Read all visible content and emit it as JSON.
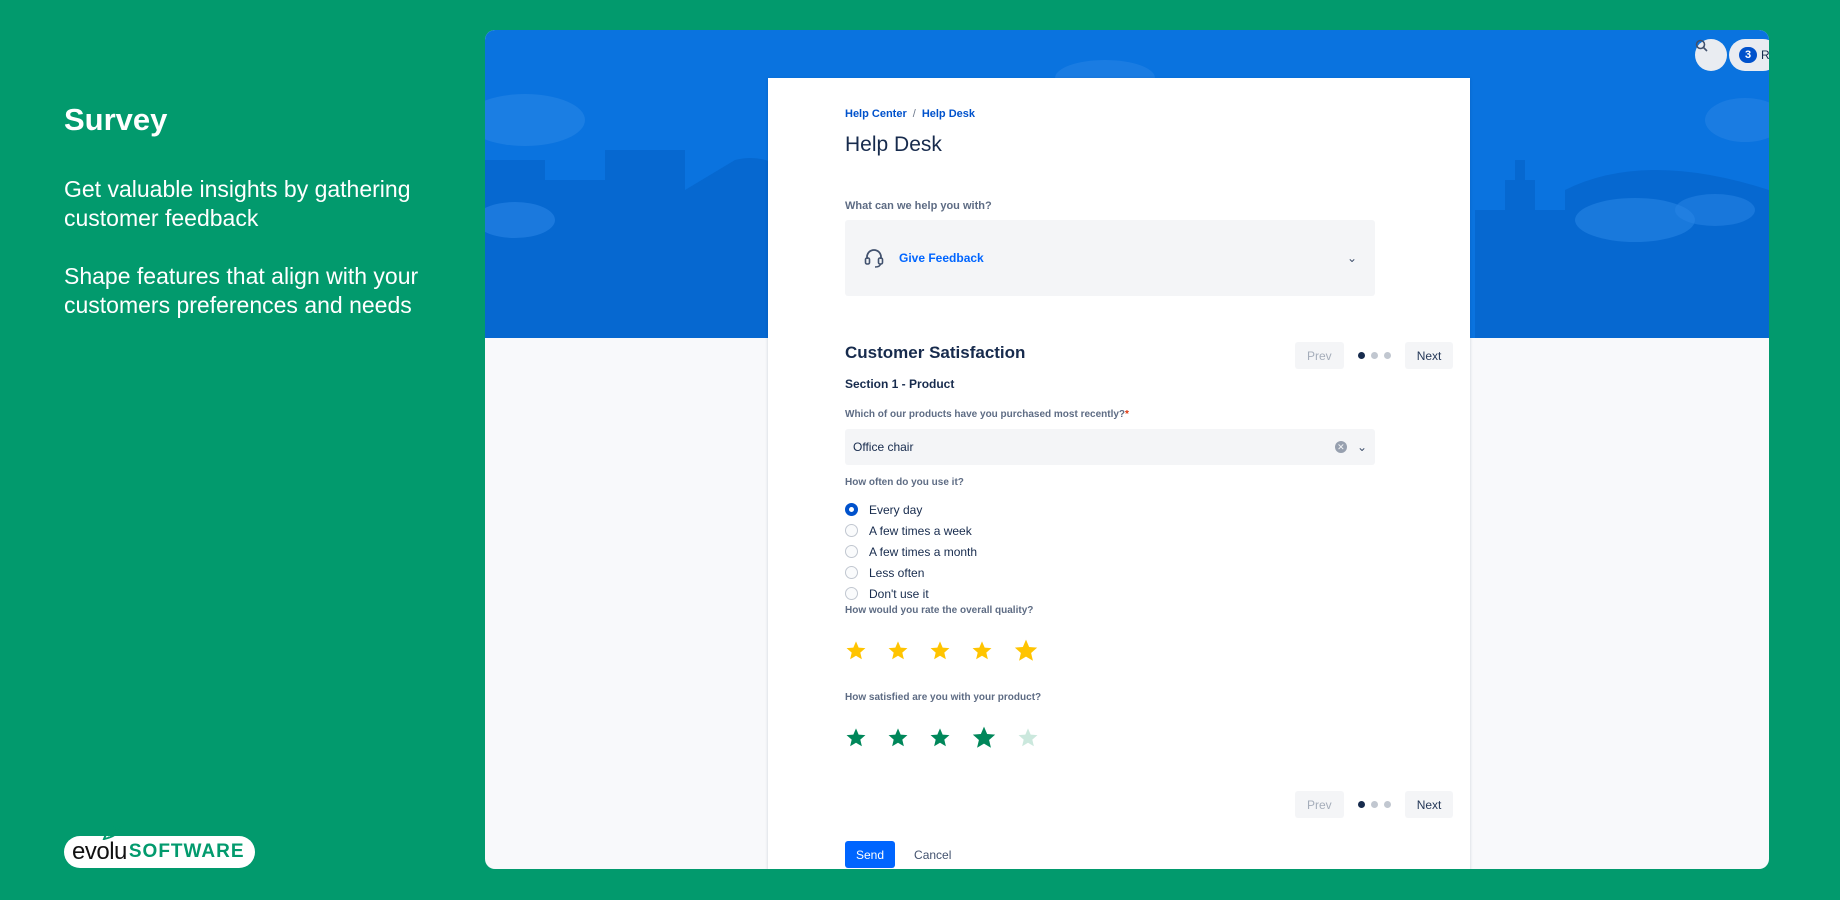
{
  "promo": {
    "title": "Survey",
    "paragraph_1": "Get valuable insights by gathering customer feedback",
    "paragraph_2": "Shape features that align with your customers preferences and needs"
  },
  "logo": {
    "part_1": "evolu",
    "part_2": "SOFTWARE"
  },
  "topbar": {
    "notification_count": "3",
    "truncated_label": "R"
  },
  "breadcrumb": {
    "item_1": "Help Center",
    "separator": "/",
    "item_2": "Help Desk"
  },
  "page_title": "Help Desk",
  "request": {
    "label": "What can we help you with?",
    "selected_type": "Give Feedback",
    "icon": "headset-icon"
  },
  "survey": {
    "title": "Customer Satisfaction",
    "section": "Section 1 - Product",
    "pager": {
      "prev_label": "Prev",
      "next_label": "Next",
      "total_pages": 3,
      "current_page": 1
    },
    "q1": {
      "label": "Which of our products have you purchased most recently?",
      "required_mark": "*",
      "value": "Office chair"
    },
    "q2": {
      "label": "How often do you use it?",
      "options": [
        "Every day",
        "A few times a week",
        "A few times a month",
        "Less often",
        "Don't use it"
      ],
      "selected_index": 0
    },
    "q3": {
      "label": "How would you rate the overall quality?",
      "rating": 5,
      "max": 5,
      "color": "#ffc400"
    },
    "q4": {
      "label": "How satisfied are you with your product?",
      "rating": 4,
      "max": 5,
      "color": "#00875a",
      "empty_color": "#cbe8dd"
    }
  },
  "actions": {
    "send_label": "Send",
    "cancel_label": "Cancel"
  },
  "colors": {
    "background": "#029a6d",
    "hero": "#0a73df",
    "accent": "#0052cc"
  }
}
